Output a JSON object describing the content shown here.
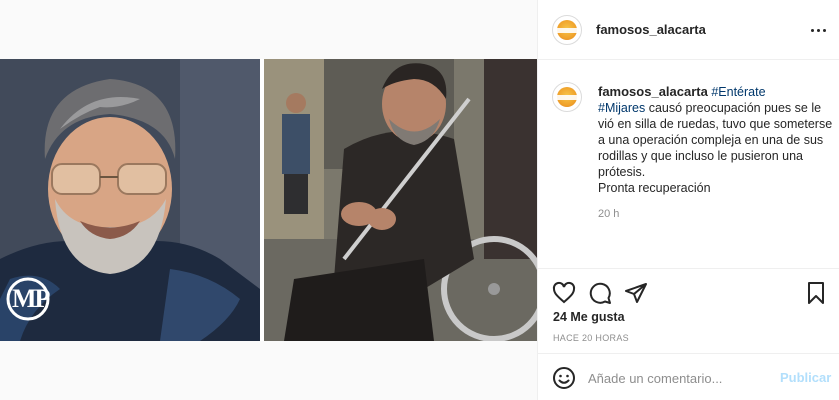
{
  "post": {
    "username": "famosos_alacarta",
    "more_icon": "more-options-icon",
    "caption": {
      "username": "famosos_alacarta",
      "hashtag1": "#Entérate",
      "hashtag2": "#Mijares",
      "text": " causó preocupación pues se le vió en silla de ruedas, tuvo que someterse a una operación compleja en una de sus rodillas y que incluso le pusieron una prótesis.",
      "extra": "Pronta recuperación"
    },
    "time_ago": "20 h",
    "likes": "24 Me gusta",
    "posted": "HACE 20 HORAS"
  },
  "media": {
    "left_logo_text": "MP"
  },
  "actions": {
    "like_icon": "heart-icon",
    "comment_icon": "comment-icon",
    "share_icon": "share-icon",
    "save_icon": "bookmark-icon"
  },
  "comment_box": {
    "placeholder": "Añade un comentario...",
    "post_label": "Publicar",
    "emoji_icon": "emoji-icon"
  },
  "colors": {
    "link": "#00376b",
    "muted": "#8e8e8e",
    "post_disabled": "#b2dffc",
    "border": "#efefef"
  }
}
